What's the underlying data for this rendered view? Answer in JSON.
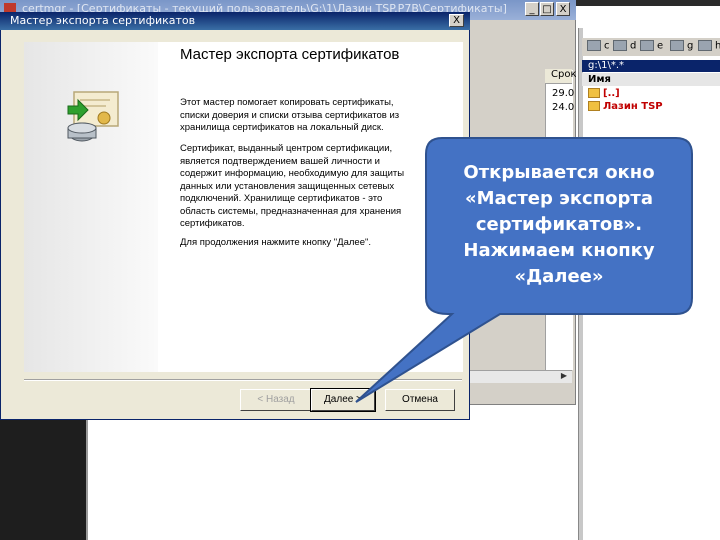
{
  "background_window": {
    "title": "certmgr - [Сертификаты - текущий пользователь\\G:\\1\\Лазин TSP.P7B\\Сертификаты]",
    "min": "_",
    "max": "□",
    "close": "X",
    "column_header": "Срок",
    "dates": [
      "29.0",
      "24.0"
    ]
  },
  "file_manager": {
    "drives": [
      "c",
      "d",
      "e",
      "g",
      "h"
    ],
    "path": "g:\\1\\*.*",
    "column_header": "Имя",
    "items": [
      "[..]",
      "Лазин TSP"
    ]
  },
  "wizard": {
    "title": "Мастер экспорта сертификатов",
    "close": "X",
    "heading": "Мастер экспорта сертификатов",
    "paragraph1": "Этот мастер помогает копировать сертификаты, списки доверия и списки отзыва сертификатов из хранилища сертификатов на локальный диск.",
    "paragraph2": "Сертификат, выданный центром сертификации, является подтверждением вашей личности и содержит информацию, необходимую для защиты данных или установления защищенных сетевых подключений. Хранилище сертификатов - это область системы, предназначенная для хранения сертификатов.",
    "paragraph3": "Для продолжения нажмите кнопку \"Далее\".",
    "back_label": "< Назад",
    "next_label": "Далее >",
    "cancel_label": "Отмена"
  },
  "callout": {
    "text": "Открывается окно «Мастер экспорта сертификатов». Нажимаем кнопку «Далее»",
    "fill": "#4472c4",
    "stroke": "#2f528f"
  }
}
